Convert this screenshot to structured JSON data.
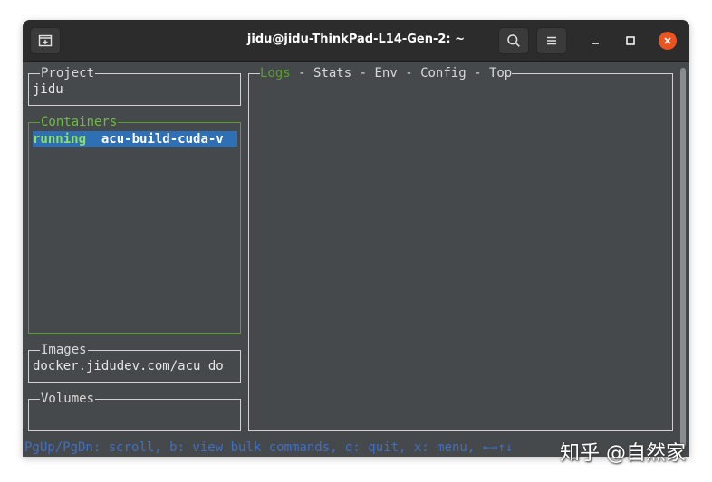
{
  "window": {
    "title": "jidu@jidu-ThinkPad-L14-Gen-2: ~"
  },
  "panels": {
    "project": {
      "title": "Project",
      "value": "jidu"
    },
    "containers": {
      "title": "Containers",
      "selected_status": "running",
      "selected_name": "acu-build-cuda-v"
    },
    "images": {
      "title": "Images",
      "value": "docker.jidudev.com/acu_do"
    },
    "volumes": {
      "title": "Volumes"
    }
  },
  "main_tabs": {
    "items": [
      "Logs",
      "Stats",
      "Env",
      "Config",
      "Top"
    ],
    "separator": " - ",
    "active": "Logs"
  },
  "statusbar": {
    "text": "PgUp/PgDn: scroll, b: view bulk commands, q: quit, x: menu, ←→↑↓"
  },
  "watermark": {
    "text": "知乎 @自然家"
  },
  "colors": {
    "terminal_bg": "#46494c",
    "active_border": "#5a9e2e",
    "selection_bg": "#2f6fb4",
    "status_text": "#3f6fc4",
    "close_button": "#e95420"
  },
  "icons": {
    "new_tab": "new-tab-icon",
    "search": "search-icon",
    "menu": "hamburger-menu-icon",
    "minimize": "minimize-icon",
    "maximize": "maximize-icon",
    "close": "close-icon"
  }
}
